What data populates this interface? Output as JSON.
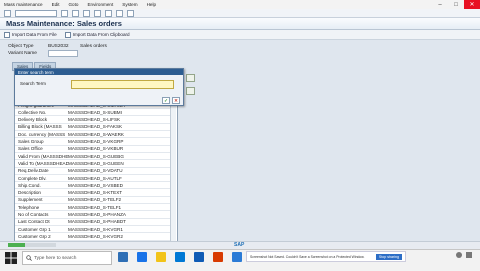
{
  "menu": {
    "items": [
      "Mass maintenance",
      "Edit",
      "Goto",
      "Environment",
      "System",
      "Help"
    ]
  },
  "header": {
    "title": "Mass Maintenance: Sales orders"
  },
  "app_toolbar": {
    "import_file": "Import Data From File",
    "import_clipboard": "Import Data From Clipboard"
  },
  "form": {
    "object_type_label": "Object Type",
    "object_type_value": "BUS2032",
    "sales_orders_label": "Sales orders",
    "variant_name_label": "Variant Name"
  },
  "tabs": [
    "Sales",
    "Fields"
  ],
  "table": {
    "rows": [
      {
        "name": "Freight guarantee",
        "field": "MASSSDHEAD_S-CMFLEY"
      },
      {
        "name": "Collective No.",
        "field": "MASSSDHEAD_S-SUBMI"
      },
      {
        "name": "Delivery Block",
        "field": "MASSSDHEAD_S-LIFSK"
      },
      {
        "name": "Billing Block (MASSS",
        "field": "MASSSDHEAD_S-FAKSK"
      },
      {
        "name": "Doc. currency (MASSS",
        "field": "MASSSDHEAD_S-WAERK"
      },
      {
        "name": "Sales Group",
        "field": "MASSSDHEAD_S-VKGRP"
      },
      {
        "name": "Sales Office",
        "field": "MASSSDHEAD_S-VKBUR"
      },
      {
        "name": "Valid From (MASSSDHE",
        "field": "MASSSDHEAD_S-GUEBG"
      },
      {
        "name": "Valid To (MASSSDHEAD",
        "field": "MASSSDHEAD_S-GUEEN"
      },
      {
        "name": "Req.Deliv.Date",
        "field": "MASSSDHEAD_S-VDATU"
      },
      {
        "name": "Complete Dlv.",
        "field": "MASSSDHEAD_S-AUTLF"
      },
      {
        "name": "Ship.Cond.",
        "field": "MASSSDHEAD_S-VSBED"
      },
      {
        "name": "Description",
        "field": "MASSSDHEAD_S-KTEXT"
      },
      {
        "name": "Supplement",
        "field": "MASSSDHEAD_S-TELF2"
      },
      {
        "name": "Telephone",
        "field": "MASSSDHEAD_S-TELF1"
      },
      {
        "name": "No of Contacts",
        "field": "MASSSDHEAD_S-PHANZA"
      },
      {
        "name": "Last Contact Dt",
        "field": "MASSSDHEAD_S-PHABDT"
      },
      {
        "name": "Customer Grp 1",
        "field": "MASSSDHEAD_S-KVGR1"
      },
      {
        "name": "Customer Grp 2",
        "field": "MASSSDHEAD_S-KVGR2"
      }
    ]
  },
  "dialog": {
    "title": "Enter search term",
    "search_label": "Search Term",
    "search_value": ""
  },
  "status": {
    "progress": 0.35
  },
  "taskbar": {
    "search_placeholder": "Type here to search",
    "notification_text": "Screenshot Not Saved. Couldn't Save a Screenshot on a Protected Window.",
    "notification_button": "Stop sharing",
    "time": "",
    "date": ""
  },
  "icons": {
    "close": "close-icon",
    "minimize": "minimize-icon",
    "maximize": "maximize-icon"
  },
  "colors": {
    "header_title": "#1a2f4e",
    "dialog_title_bg": "#2d5d91",
    "taskbar_button": "#2d6ec6",
    "progress": "#4caf50"
  }
}
